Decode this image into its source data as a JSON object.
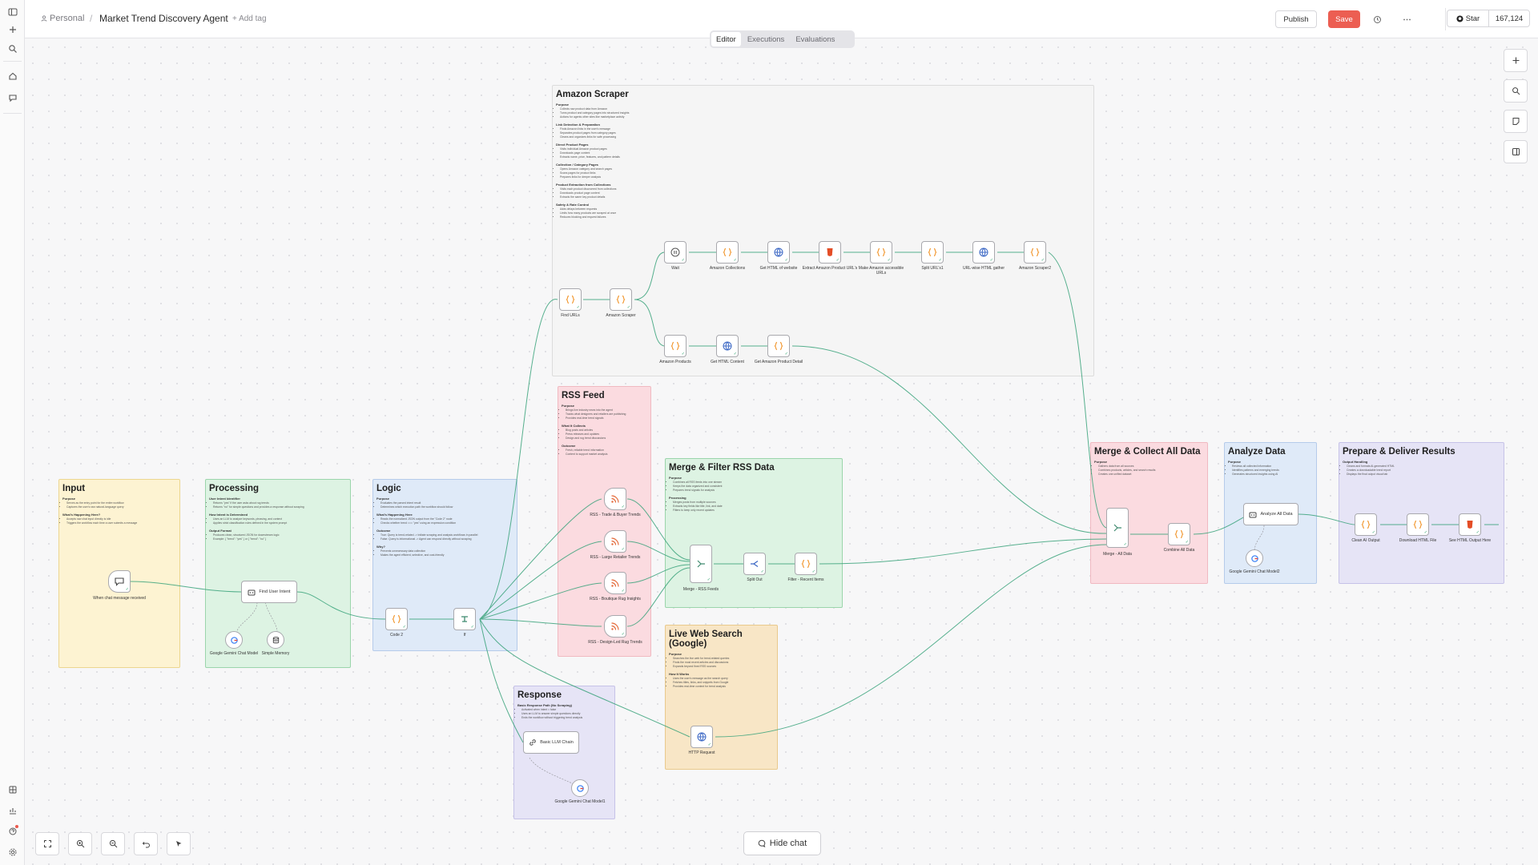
{
  "header": {
    "personal_label": "Personal",
    "separator": "/",
    "workflow_title": "Market Trend Discovery Agent",
    "add_tag_label": "+ Add tag",
    "publish_label": "Publish",
    "save_label": "Save",
    "github_star_label": "Star",
    "github_star_count": "167,124"
  },
  "tabs": [
    "Editor",
    "Executions",
    "Evaluations"
  ],
  "active_tab": "Editor",
  "bottom": {
    "hide_chat_label": "Hide chat"
  },
  "colors": {
    "accent": "#ec5e52",
    "wire": "#3aa37b"
  },
  "stickies": {
    "amazon": {
      "title": "Amazon Scraper",
      "sections": [
        {
          "heading": "Purpose",
          "items": [
            "Collects raw product data from Amazon",
            "Turns product and category pages into structured insights",
            "Actions for agents other sites like marketplace activity"
          ]
        },
        {
          "heading": "Link Detection & Preparation",
          "items": [
            "Finds Amazon links in the user's message",
            "Separates product pages from category pages",
            "Cleans and organizes links for safe processing"
          ]
        },
        {
          "heading": "Direct Product Pages",
          "items": [
            "Visits individual Amazon product pages",
            "Downloads page content",
            "Extracts name, price, features, and pattern details"
          ]
        },
        {
          "heading": "Collection / Category Pages",
          "items": [
            "Opens Amazon category and search pages",
            "Scans pages for product links",
            "Prepares links for deeper analysis"
          ]
        },
        {
          "heading": "Product Extraction from Collections",
          "items": [
            "Visits each product discovered from collections",
            "Downloads product page content",
            "Extracts the same key product details"
          ]
        },
        {
          "heading": "Safety & Rate Control",
          "items": [
            "Adds delays between requests",
            "Limits how many products are scraped at once",
            "Reduces blocking and request failures"
          ]
        }
      ]
    },
    "rss": {
      "title": "RSS Feed",
      "sections": [
        {
          "heading": "Purpose",
          "items": [
            "Brings live industry news into the agent",
            "Tracks what designers and retailers are publishing",
            "Provides real-time trend signals"
          ]
        },
        {
          "heading": "What It Collects",
          "items": [
            "Blog posts and articles",
            "Press releases and updates",
            "Design and rug trend discussions"
          ]
        },
        {
          "heading": "Outcome",
          "items": [
            "Fresh, reliable trend information",
            "Content to support market analysis"
          ]
        }
      ]
    },
    "merge_rss": {
      "title": "Merge & Filter RSS Data",
      "sections": [
        {
          "heading": "Purpose",
          "items": [
            "Combines all RSS feeds into one stream",
            "Keeps the data organized and consistent",
            "Prepares trend signals for analysis"
          ]
        },
        {
          "heading": "Processing",
          "items": [
            "Merges posts from multiple sources",
            "Extracts key fields like title, link, and date",
            "Filters to keep only recent updates"
          ]
        }
      ]
    },
    "input": {
      "title": "Input",
      "sections": [
        {
          "heading": "Purpose",
          "items": [
            "Serves as the entry point for the entire workflow",
            "Captures the user's raw natural-language query"
          ]
        },
        {
          "heading": "What's Happening Here?",
          "items": [
            "Accepts raw chat input directly is idle",
            "Triggers the workflow each time a user submits a message"
          ]
        }
      ]
    },
    "processing": {
      "title": "Processing",
      "sections": [
        {
          "heading": "User Intent Identifier",
          "items": [
            "Returns \"yes\" if the user asks about rug trends",
            "Returns \"no\" for simple questions and provides a response without scraping"
          ]
        },
        {
          "heading": "How Intent is Determined",
          "items": [
            "Uses an LLM to analyze keywords, phrasing, and context",
            "Applies strict classification rules defined in the system prompt"
          ]
        },
        {
          "heading": "Output Format",
          "items": [
            "Produces clean, structured JSON for downstream logic",
            "Example: { \"trend\": \"yes\" } or { \"trend\": \"no\" }"
          ]
        }
      ]
    },
    "logic": {
      "title": "Logic",
      "sections": [
        {
          "heading": "Purpose",
          "items": [
            "Evaluates the parsed intent result",
            "Determines which execution path the workflow should follow"
          ]
        },
        {
          "heading": "What's Happening Here",
          "items": [
            "Reads the normalized JSON output from the \"Code 2\" node",
            "Checks whether trend === \"yes\" using an expression condition"
          ]
        },
        {
          "heading": "Outcome",
          "items": [
            "True: Query is trend-related -> Initiate scraping and analysis workflows in parallel",
            "False: Query is informational -> Agent can respond directly without scraping"
          ]
        },
        {
          "heading": "Why?",
          "items": [
            "Prevents unnecessary data collection",
            "Makes the agent efficient, selective, and cost-friendly"
          ]
        }
      ]
    },
    "response": {
      "title": "Response",
      "sections": [
        {
          "heading": "Basic Response Path (No Scraping)",
          "items": [
            "Activated when intent = false",
            "Uses an LLM to answer simple questions directly",
            "Ends the workflow without triggering trend analysis"
          ]
        }
      ]
    },
    "web_search": {
      "title": "Live Web Search (Google)",
      "sections": [
        {
          "heading": "Purpose",
          "items": [
            "Searches the live web for trend-related queries",
            "Finds the most recent articles and discussions",
            "Expands beyond fixed RSS sources"
          ]
        },
        {
          "heading": "How It Works",
          "items": [
            "Uses the user's message as the search query",
            "Fetches titles, links, and snippets from Google",
            "Provides real-time context for trend analysis"
          ]
        }
      ]
    },
    "merge_all": {
      "title": "Merge & Collect All Data",
      "sections": [
        {
          "heading": "Purpose",
          "items": [
            "Gathers data from all sources",
            "Combines products, articles, and search results",
            "Creates one unified dataset"
          ]
        }
      ]
    },
    "analyze": {
      "title": "Analyze Data",
      "sections": [
        {
          "heading": "Purpose",
          "items": [
            "Reviews all collected information",
            "Identifies patterns and emerging trends",
            "Generates structured insights using AI"
          ]
        }
      ]
    },
    "deliver": {
      "title": "Prepare & Deliver Results",
      "sections": [
        {
          "heading": "Output Handling",
          "items": [
            "Cleans and formats AI-generated HTML",
            "Creates a downloadable trend report",
            "Displays the final output visual tab"
          ]
        }
      ]
    }
  },
  "nodes": {
    "chat_trigger": "When chat message received",
    "find_user_intent": "Find User Intent",
    "gemini_1": "Google Gemini Chat Model",
    "simple_memory": "Simple Memory",
    "code2": "Code 2",
    "if": "If",
    "find_urls": "Find URLs",
    "amazon_scraper": "Amazon Scraper",
    "wait": "Wait",
    "amazon_collections": "Amazon Collections",
    "get_html_website": "Get HTML of website",
    "extract_amazon_urls": "Extract Amazon Product URL's",
    "make_amazon_urls": "Make Amazon accessible URLs",
    "split_url": "Split URL's1",
    "url_html_gather": "URL-wise HTML gather",
    "amazon_scraper2": "Amazon Scraper2",
    "amazon_products": "Amazon Products",
    "get_html_content": "Get HTML Content",
    "get_amazon_detail": "Get Amazon Product Detail",
    "rss_trade": "RSS - Trade & Buyer Trends",
    "rss_retailer": "RSS - Large Retailer Trends",
    "rss_boutique": "RSS - Boutique Rug Insights",
    "rss_design": "RSS - Design-Led Rug Trends",
    "merge_rss_feeds": "Merge - RSS Feeds",
    "split_out": "Split Out",
    "filter_recent": "Filter - Recent Items",
    "basic_llm_chain": "Basic LLM Chain",
    "gemini_response": "Google Gemini Chat Model1",
    "http_request": "HTTP Request",
    "merge_all": "Merge - All Data",
    "combine_all": "Combine All Data",
    "analyze_all": "Analyze All Data",
    "gemini_analyze": "Google Gemini Chat Model2",
    "clean_ai_output": "Clean AI Output",
    "download_html": "Download HTML File",
    "see_html_output": "See HTML Output Here"
  }
}
